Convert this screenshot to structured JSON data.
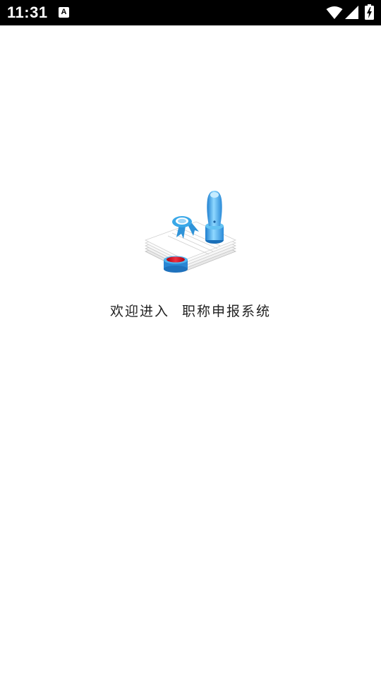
{
  "status_bar": {
    "time": "11:31",
    "notification_letter": "A",
    "icons": [
      "wifi-icon",
      "cellular-signal-icon",
      "battery-charging-icon"
    ]
  },
  "splash": {
    "logo_icon": "certificate-stamp-icon",
    "welcome_text": "欢迎进入",
    "app_name": "职称申报系统"
  },
  "colors": {
    "status_bar_bg": "#000000",
    "page_bg": "#ffffff",
    "stamp_blue": "#3aa8e8",
    "ink_red": "#d01020"
  }
}
